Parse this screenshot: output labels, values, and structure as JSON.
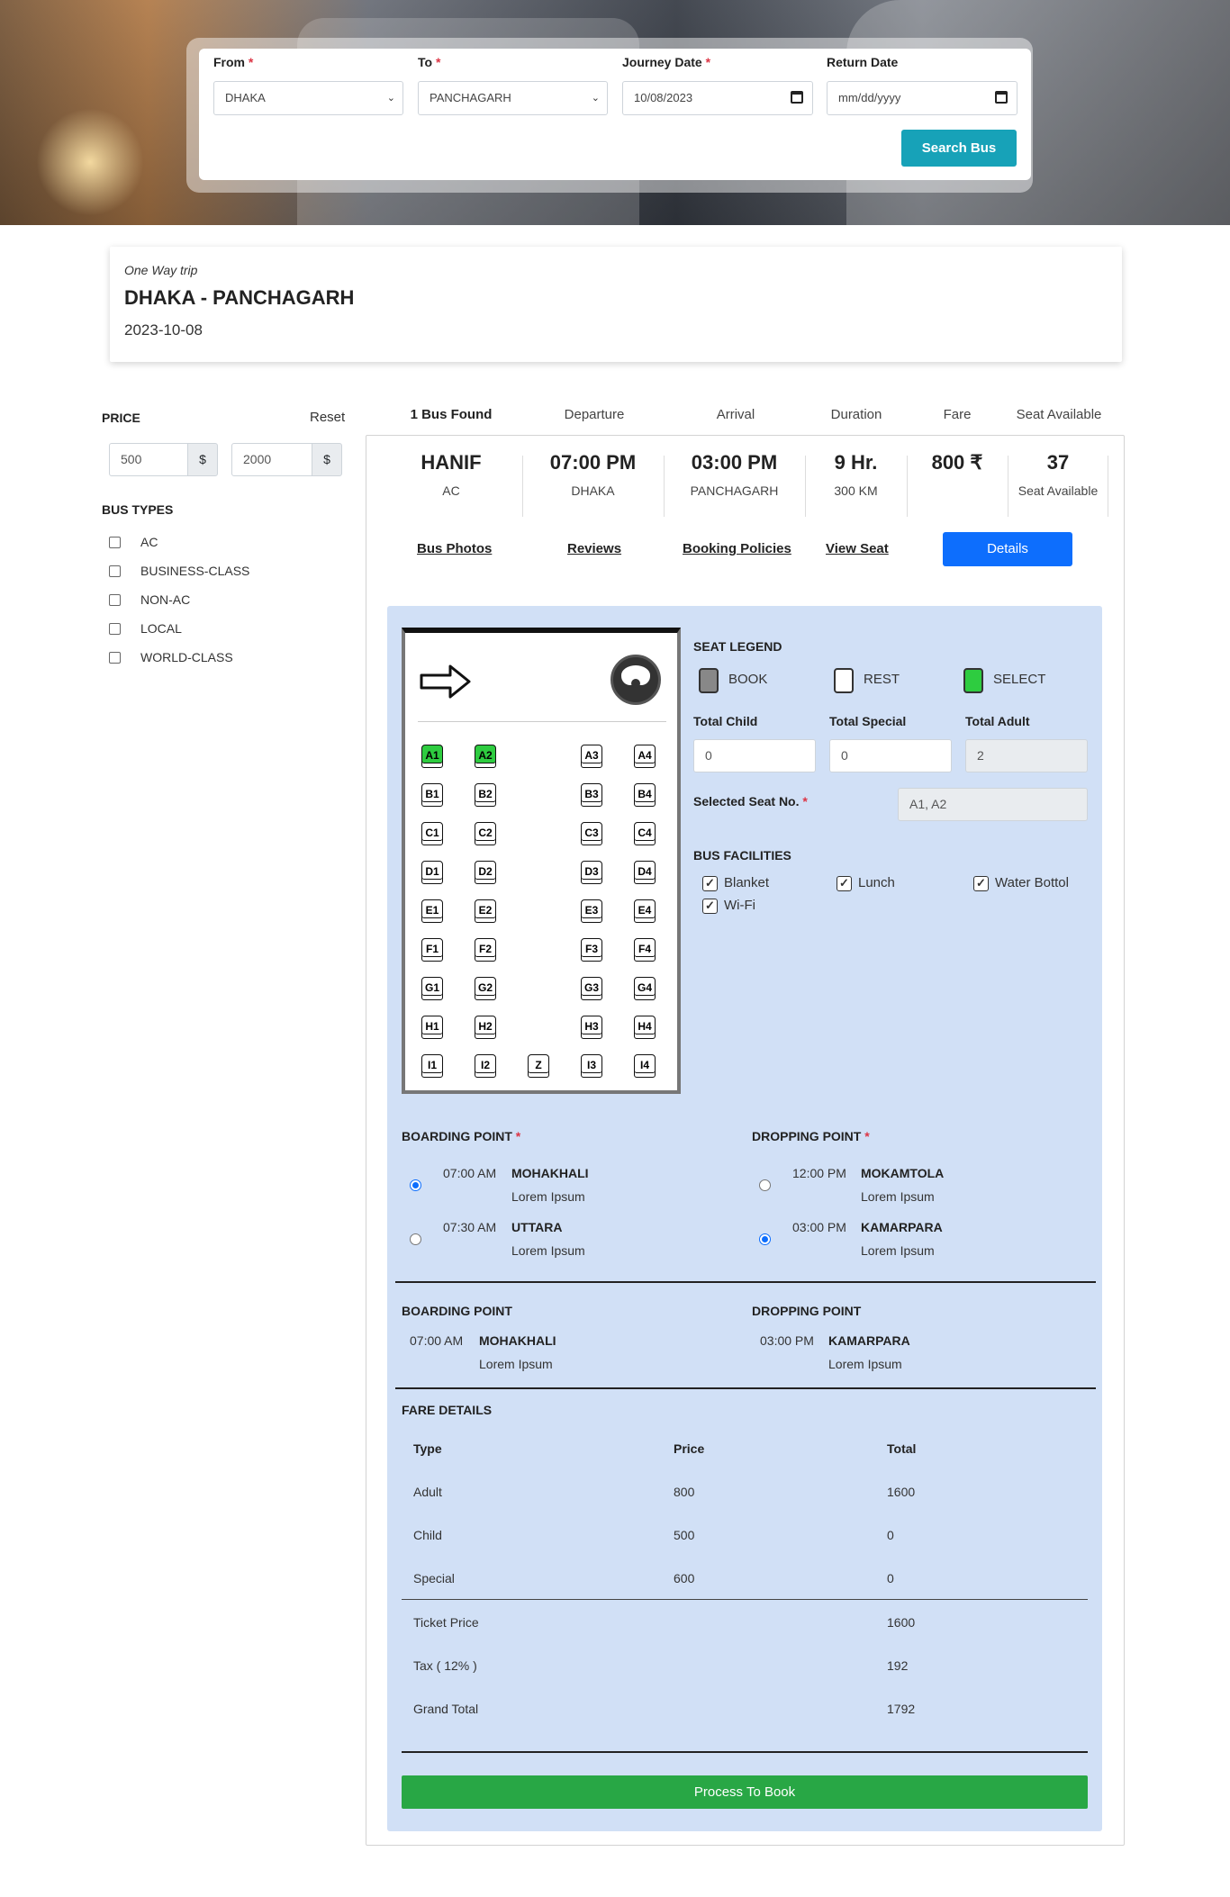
{
  "search": {
    "from_label": "From",
    "to_label": "To",
    "journey_label": "Journey Date",
    "return_label": "Return Date",
    "from_value": "DHAKA",
    "to_value": "PANCHAGARH",
    "journey_value": "10/08/2023",
    "return_placeholder": "mm/dd/yyyy",
    "button": "Search Bus"
  },
  "trip": {
    "type": "One Way trip",
    "route": "DHAKA - PANCHAGARH",
    "date": "2023-10-08"
  },
  "filters": {
    "price_title": "PRICE",
    "reset": "Reset",
    "price_min": "500",
    "price_max": "2000",
    "currency": "$",
    "bus_types_title": "BUS TYPES",
    "bus_types": [
      "AC",
      "BUSINESS-CLASS",
      "NON-AC",
      "LOCAL",
      "WORLD-CLASS"
    ]
  },
  "results_header": {
    "found": "1 Bus Found",
    "departure": "Departure",
    "arrival": "Arrival",
    "duration": "Duration",
    "fare": "Fare",
    "seat_available": "Seat Available"
  },
  "bus": {
    "name": "HANIF",
    "class": "AC",
    "departure_time": "07:00 PM",
    "departure_place": "DHAKA",
    "arrival_time": "03:00 PM",
    "arrival_place": "PANCHAGARH",
    "duration": "9 Hr.",
    "distance": "300 KM",
    "fare": "800 ₹",
    "seats": "37",
    "seats_label": "Seat Available"
  },
  "tabs": {
    "photos": "Bus Photos",
    "reviews": "Reviews",
    "policies": "Booking Policies",
    "view_seat": "View Seat",
    "details": "Details"
  },
  "seat_map": {
    "rows": [
      [
        "A1",
        "A2",
        "A3",
        "A4"
      ],
      [
        "B1",
        "B2",
        "B3",
        "B4"
      ],
      [
        "C1",
        "C2",
        "C3",
        "C4"
      ],
      [
        "D1",
        "D2",
        "D3",
        "D4"
      ],
      [
        "E1",
        "E2",
        "E3",
        "E4"
      ],
      [
        "F1",
        "F2",
        "F3",
        "F4"
      ],
      [
        "G1",
        "G2",
        "G3",
        "G4"
      ],
      [
        "H1",
        "H2",
        "H3",
        "H4"
      ],
      [
        "I1",
        "I2",
        "Z",
        "I3",
        "I4"
      ]
    ],
    "selected": [
      "A1",
      "A2"
    ],
    "selected_color": "#2ecc40"
  },
  "legend": {
    "title": "SEAT LEGEND",
    "book": "BOOK",
    "rest": "REST",
    "select": "SELECT"
  },
  "counts": {
    "child_label": "Total Child",
    "special_label": "Total Special",
    "adult_label": "Total Adult",
    "child": "0",
    "special": "0",
    "adult": "2",
    "selected_label": "Selected Seat No.",
    "selected": "A1, A2"
  },
  "facilities": {
    "title": "BUS FACILITIES",
    "items": [
      "Blanket",
      "Lunch",
      "Water Bottol",
      "Wi-Fi"
    ]
  },
  "boarding": {
    "title": "BOARDING POINT",
    "points": [
      {
        "time": "07:00 AM",
        "name": "MOHAKHALI",
        "desc": "Lorem Ipsum"
      },
      {
        "time": "07:30 AM",
        "name": "UTTARA",
        "desc": "Lorem Ipsum"
      }
    ]
  },
  "dropping": {
    "title": "DROPPING POINT",
    "points": [
      {
        "time": "12:00 PM",
        "name": "MOKAMTOLA",
        "desc": "Lorem Ipsum"
      },
      {
        "time": "03:00 PM",
        "name": "KAMARPARA",
        "desc": "Lorem Ipsum"
      }
    ]
  },
  "summary": {
    "boarding_title": "BOARDING POINT",
    "boarding_time": "07:00 AM",
    "boarding_name": "MOHAKHALI",
    "boarding_desc": "Lorem Ipsum",
    "dropping_title": "DROPPING POINT",
    "dropping_time": "03:00 PM",
    "dropping_name": "KAMARPARA",
    "dropping_desc": "Lorem Ipsum"
  },
  "fare": {
    "title": "FARE DETAILS",
    "col_type": "Type",
    "col_price": "Price",
    "col_total": "Total",
    "rows": [
      {
        "type": "Adult",
        "price": "800",
        "total": "1600"
      },
      {
        "type": "Child",
        "price": "500",
        "total": "0"
      },
      {
        "type": "Special",
        "price": "600",
        "total": "0"
      }
    ],
    "ticket_label": "Ticket Price",
    "ticket": "1600",
    "tax_label": "Tax ( 12% )",
    "tax": "192",
    "grand_label": "Grand Total",
    "grand": "1792",
    "button": "Process To Book"
  },
  "colors": {
    "accent_teal": "#17a2b8",
    "primary": "#0d6efd",
    "success": "#28a745",
    "panel_bg": "#d1e0f6"
  }
}
